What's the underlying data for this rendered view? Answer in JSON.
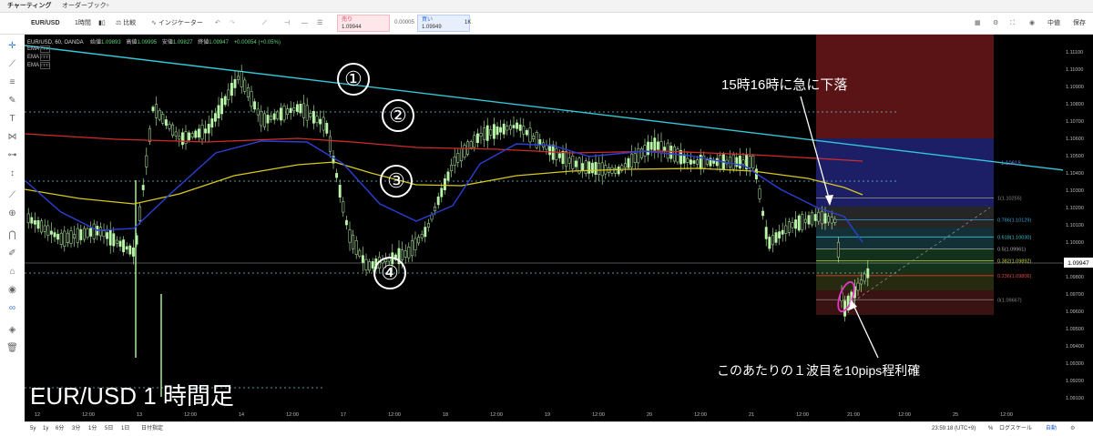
{
  "tabs": [
    {
      "label": "チャーティング"
    },
    {
      "label": "オーダーブック"
    },
    {
      "label": "+"
    }
  ],
  "toolbar": {
    "symbol": "EUR/USD",
    "interval": "1時間",
    "compare": "比較",
    "indicators": "インジケーター",
    "sell_label": "売り",
    "sell_price": "1.09944",
    "spread": "0.00005",
    "buy_label": "買い",
    "buy_price": "1.09949",
    "quantity": "1K",
    "layout_select": "中値",
    "save": "保存"
  },
  "legend": {
    "title": "EUR/USD, 60, OANDA",
    "open_label": "始値",
    "open": "1.09893",
    "high_label": "高値",
    "high": "1.09995",
    "low_label": "安値",
    "low": "1.09827",
    "close_label": "終値",
    "close": "1.09947",
    "change": "+0.00054 (+0.05%)",
    "ema_labels": [
      "EMA",
      "EMA",
      "EMA"
    ]
  },
  "annotations": {
    "circle1": "①",
    "circle2": "②",
    "circle3": "③",
    "circle4": "④",
    "drop_note": "15時16時に急に下落",
    "profit_note": "このあたりの１波目を10pips程利確",
    "chart_caption": "EUR/USD 1 時間足"
  },
  "fib_levels": [
    {
      "label": "1(1.10255)",
      "price": 1.10255
    },
    {
      "label": "0.786(1.10129)",
      "price": 1.10129
    },
    {
      "label": "0.618(1.10030)",
      "price": 1.1003
    },
    {
      "label": "0.5(1.09961)",
      "price": 1.09961
    },
    {
      "label": "0.382(1.09892)",
      "price": 1.09892
    },
    {
      "label": "0.236(1.09806)",
      "price": 1.09806
    },
    {
      "label": "0(1.09667)",
      "price": 1.09667
    }
  ],
  "fib_overlay_label": "1.10618",
  "price_axis": {
    "ticks": [
      "1.11100",
      "1.11000",
      "1.10900",
      "1.10800",
      "1.10700",
      "1.10600",
      "1.10500",
      "1.10400",
      "1.10300",
      "1.10200",
      "1.10100",
      "1.10000",
      "1.09900",
      "1.09800",
      "1.09700",
      "1.09600",
      "1.09500",
      "1.09400",
      "1.09300",
      "1.09200",
      "1.09100"
    ],
    "current_price": "1.09947"
  },
  "time_axis": {
    "labels": [
      "12",
      "12:00",
      "13",
      "12:00",
      "14",
      "12:00",
      "17",
      "12:00",
      "18",
      "12:00",
      "19",
      "12:00",
      "20",
      "12:00",
      "21",
      "12:00",
      "21:00",
      "12:00",
      "25",
      "12:00"
    ]
  },
  "bottombar": {
    "ranges": [
      "5y",
      "1y",
      "6分",
      "3分",
      "1分",
      "5日",
      "1日"
    ],
    "goto_date": "日付指定",
    "clock": "23:59:18 (UTC+9)",
    "percent": "%",
    "log": "ログスケール",
    "auto": "自動"
  },
  "colors": {
    "trendline": "#33c7d8",
    "ema_red": "#d22a2a",
    "ema_blue": "#2a3fd6",
    "ema_yellow": "#d8c81e",
    "candle": "#b9f7a8",
    "fib_red_zone": "#5a1416",
    "fib_blue_zone": "#1c1f66",
    "pink_ellipse": "#e535c6"
  }
}
